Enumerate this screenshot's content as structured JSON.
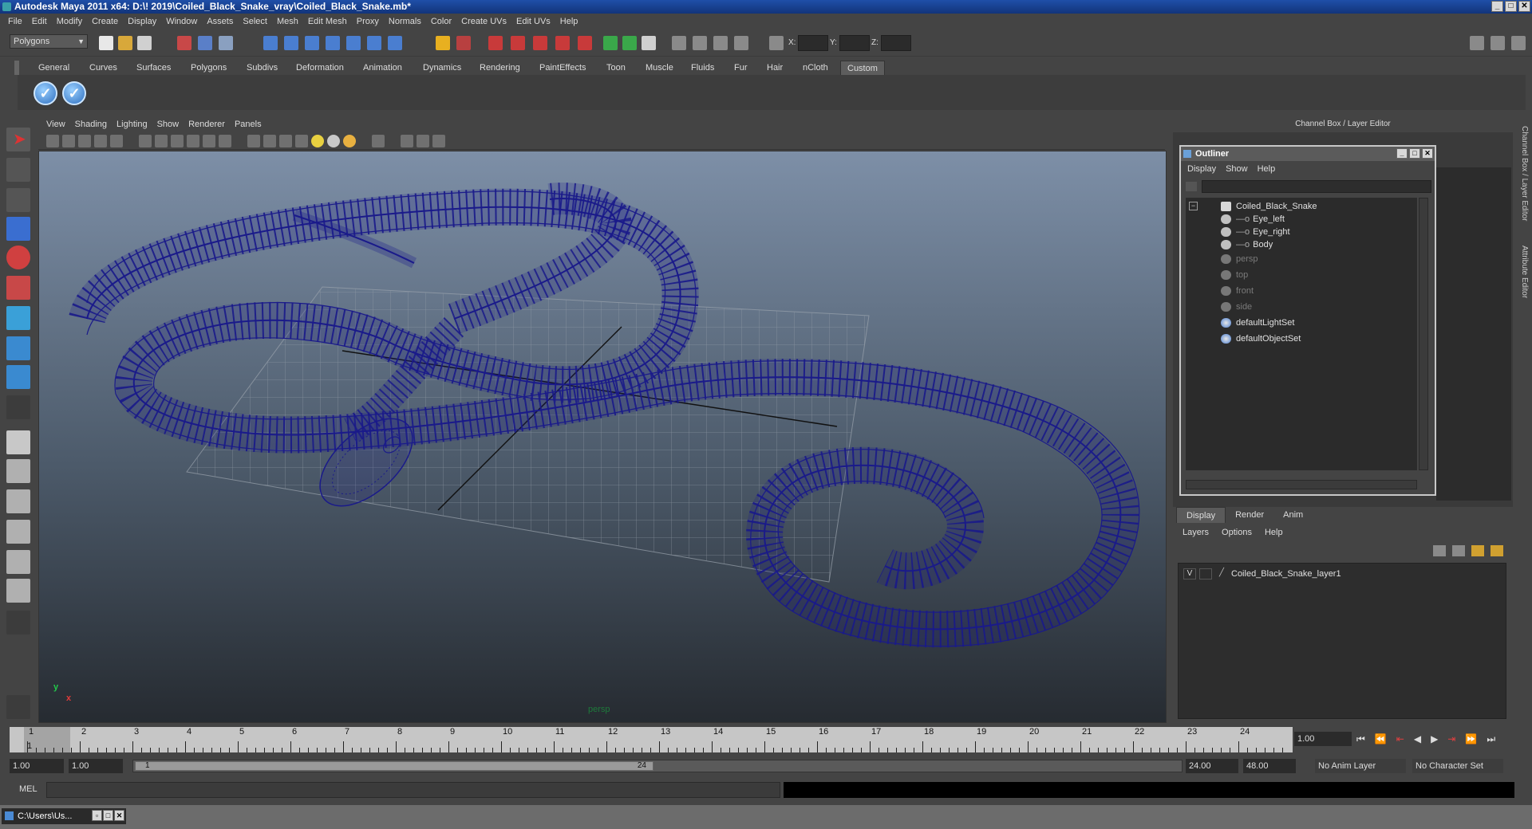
{
  "window": {
    "title": "Autodesk Maya 2011 x64: D:\\! 2019\\Coiled_Black_Snake_vray\\Coiled_Black_Snake.mb*"
  },
  "menubar": [
    "File",
    "Edit",
    "Modify",
    "Create",
    "Display",
    "Window",
    "Assets",
    "Select",
    "Mesh",
    "Edit Mesh",
    "Proxy",
    "Normals",
    "Color",
    "Create UVs",
    "Edit UVs",
    "Help"
  ],
  "status_line": {
    "mode": "Polygons",
    "x_label": "X:",
    "y_label": "Y:",
    "z_label": "Z:"
  },
  "shelf_tabs": [
    "General",
    "Curves",
    "Surfaces",
    "Polygons",
    "Subdivs",
    "Deformation",
    "Animation",
    "Dynamics",
    "Rendering",
    "PaintEffects",
    "Toon",
    "Muscle",
    "Fluids",
    "Fur",
    "Hair",
    "nCloth",
    "Custom"
  ],
  "shelf_active_tab": "Custom",
  "viewport_menu": [
    "View",
    "Shading",
    "Lighting",
    "Show",
    "Renderer",
    "Panels"
  ],
  "viewport": {
    "camera_label": "persp",
    "axis_y": "y",
    "axis_x": "x"
  },
  "right_panel": {
    "header": "Channel Box / Layer Editor",
    "vtab_channel": "Channel Box / Layer Editor",
    "vtab_attr": "Attribute Editor"
  },
  "outliner": {
    "title": "Outliner",
    "menu": [
      "Display",
      "Show",
      "Help"
    ],
    "items": [
      {
        "label": "Coiled_Black_Snake",
        "depth": 0,
        "dim": false,
        "icon": "transform-icon"
      },
      {
        "label": "Eye_left",
        "depth": 1,
        "dim": false,
        "icon": "mesh-icon"
      },
      {
        "label": "Eye_right",
        "depth": 1,
        "dim": false,
        "icon": "mesh-icon"
      },
      {
        "label": "Body",
        "depth": 1,
        "dim": false,
        "icon": "mesh-icon"
      },
      {
        "label": "persp",
        "depth": 0,
        "dim": true,
        "icon": "camera-icon"
      },
      {
        "label": "top",
        "depth": 0,
        "dim": true,
        "icon": "camera-icon"
      },
      {
        "label": "front",
        "depth": 0,
        "dim": true,
        "icon": "camera-icon"
      },
      {
        "label": "side",
        "depth": 0,
        "dim": true,
        "icon": "camera-icon"
      },
      {
        "label": "defaultLightSet",
        "depth": 0,
        "dim": false,
        "icon": "set-icon"
      },
      {
        "label": "defaultObjectSet",
        "depth": 0,
        "dim": false,
        "icon": "set-icon"
      }
    ]
  },
  "layer_editor": {
    "tabs": [
      "Display",
      "Render",
      "Anim"
    ],
    "active_tab": "Display",
    "menu": [
      "Layers",
      "Options",
      "Help"
    ],
    "layers": [
      {
        "visible": "V",
        "name": "Coiled_Black_Snake_layer1"
      }
    ]
  },
  "timeline": {
    "ticks": [
      "1",
      "2",
      "3",
      "4",
      "5",
      "6",
      "7",
      "8",
      "9",
      "10",
      "11",
      "12",
      "13",
      "14",
      "15",
      "16",
      "17",
      "18",
      "19",
      "20",
      "21",
      "22",
      "23",
      "24"
    ],
    "current_frame_marker": "1",
    "current_time": "1.00"
  },
  "range": {
    "start": "1.00",
    "playback_start": "1.00",
    "handle_start": "1",
    "handle_end": "24",
    "playback_end": "24.00",
    "end": "48.00",
    "anim_layer": "No Anim Layer",
    "character_set": "No Character Set"
  },
  "command_line": {
    "label": "MEL"
  },
  "taskbar": {
    "item": "C:\\Users\\Us..."
  },
  "colors": {
    "wireframe": "#1a1a8a",
    "accent": "#2e6fc0",
    "titlebar": "#1f4fa8"
  }
}
